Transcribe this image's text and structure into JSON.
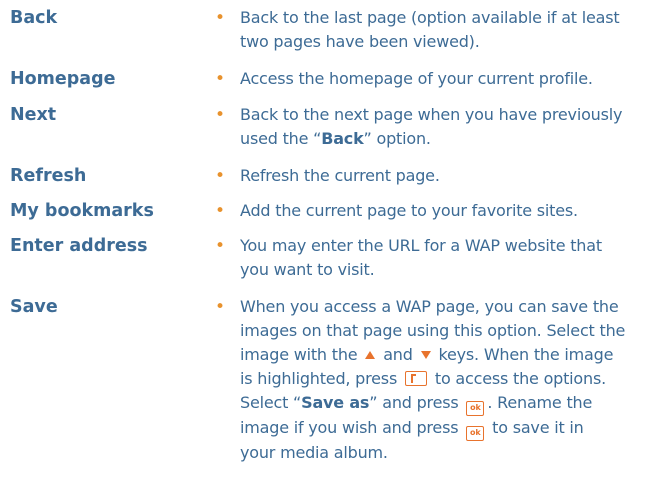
{
  "entries": [
    {
      "term": "Back",
      "lines": [
        "Back to the last page (option available if at least",
        "two pages have been viewed)."
      ]
    },
    {
      "term": "Homepage",
      "lines": [
        "Access the homepage of your current profile."
      ]
    },
    {
      "term": "Next",
      "lines": [
        "Back to the next page when you have previously"
      ],
      "line2_prefix": "used the “",
      "line2_bold": "Back",
      "line2_suffix": "” option."
    },
    {
      "term": "Refresh",
      "lines": [
        "Refresh the current page."
      ]
    },
    {
      "term": "My bookmarks",
      "lines": [
        "Add the current page to your favorite sites."
      ]
    },
    {
      "term": "Enter address",
      "lines": [
        "You may enter the URL for a WAP website that",
        "you want to visit."
      ]
    },
    {
      "term": "Save",
      "line1": "When you access a WAP page, you can save the",
      "line2": "images on that page using this option. Select the",
      "line3_a": "image with the",
      "line3_b": "and",
      "line3_c": "keys. When the image",
      "line4_a": "is highlighted, press",
      "line4_b": "to access the options.",
      "line5_a": "Select “",
      "line5_bold": "Save as",
      "line5_b": "” and press",
      "line5_c": ". Rename the",
      "line6_a": "image if you wish and press",
      "line6_b": "to save it in",
      "line7": "your media album.",
      "ok_key_label": "ok",
      "up_icon": "up-arrow-key-icon",
      "down_icon": "down-arrow-key-icon",
      "softkey_icon": "left-softkey-icon",
      "ok_icon": "ok-key-icon"
    }
  ],
  "bullet": "•",
  "colors": {
    "text": "#3d6b95",
    "bullet": "#e8922d",
    "icon": "#e8732d"
  }
}
